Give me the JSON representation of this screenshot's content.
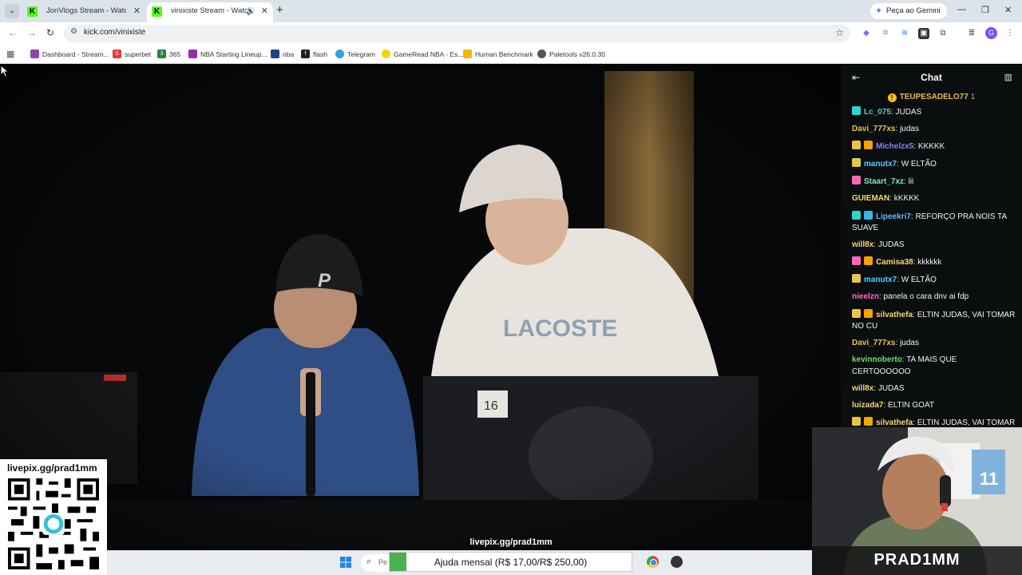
{
  "browser": {
    "tabs": [
      {
        "title": "JonVlogs Stream - Watch Live on Kick",
        "favicon": "K",
        "active": false
      },
      {
        "title": "vinixiste Stream - Watch Live on Kick",
        "favicon": "K",
        "active": true
      }
    ],
    "gemini_label": "Peça ao Gemini",
    "url": "kick.com/vinixiste",
    "bookmarks": [
      {
        "label": "Dashboard - Stream...",
        "color": "#8e44ad"
      },
      {
        "label": "superbet",
        "color": "#e53935",
        "glyph": "S"
      },
      {
        "label": "365",
        "color": "#1b8a3a",
        "glyph": "3"
      },
      {
        "label": "NBA Starting Lineup...",
        "color": "#9c27b0"
      },
      {
        "label": "nba",
        "color": "#1d428a"
      },
      {
        "label": "flash",
        "color": "#222",
        "glyph": "f"
      },
      {
        "label": "Telegram",
        "color": "#2aa3df"
      },
      {
        "label": "GameRead NBA - Es...",
        "color": "#f5d20b"
      },
      {
        "label": "Human Benchmark",
        "color": "#f7b500"
      },
      {
        "label": "Paletools v26.0.30",
        "color": "#555"
      }
    ]
  },
  "overlay": {
    "qr_url": "livepix.gg/prad1mm",
    "stream_url": "livepix.gg/prad1mm",
    "search_placeholder": "Pe",
    "donation_text": "Ajuda mensal (R$ 17,00/R$ 250,00)",
    "donation_current": 17,
    "donation_goal": 250,
    "webcam_name": "PRAD1MM"
  },
  "chat": {
    "title": "Chat",
    "pinned_user": "TEUPESADELO77",
    "pinned_count": "1",
    "messages": [
      {
        "badges": [
          "gift"
        ],
        "user": "Lc_075",
        "color": "#4fd1c5",
        "text": "JUDAS"
      },
      {
        "badges": [],
        "user": "Davi_777xs",
        "color": "#e8c547",
        "text": "judas"
      },
      {
        "badges": [
          "sub",
          "crown"
        ],
        "user": "Michelzx5",
        "color": "#8f7cff",
        "text": "KKKKK"
      },
      {
        "badges": [
          "sub"
        ],
        "user": "manutx7",
        "color": "#4fd1ff",
        "text": "W ELTÃO"
      },
      {
        "badges": [
          "pink"
        ],
        "user": "Staart_7xz",
        "color": "#7ee7c7",
        "text": "lii"
      },
      {
        "badges": [],
        "user": "GUIEMAN",
        "color": "#f5d76e",
        "text": "kKKKK"
      },
      {
        "badges": [
          "gift",
          "og"
        ],
        "user": "Lipeekri7",
        "color": "#60b8ff",
        "text": "REFORÇO PRA NOIS TA SUAVE"
      },
      {
        "badges": [],
        "user": "will8x",
        "color": "#f5d76e",
        "text": "JUDAS"
      },
      {
        "badges": [
          "pink",
          "crown"
        ],
        "user": "Camisa38",
        "color": "#f5d76e",
        "text": "kkkkkk"
      },
      {
        "badges": [
          "sub"
        ],
        "user": "manutx7",
        "color": "#4fd1ff",
        "text": "W ELTÃO"
      },
      {
        "badges": [],
        "user": "nieelzn",
        "color": "#ff6ec7",
        "text": "panela o cara dnv ai fdp"
      },
      {
        "badges": [
          "sub",
          "crown"
        ],
        "user": "silvathefa",
        "color": "#f5d76e",
        "text": "ELTIN JUDAS, VAI TOMAR NO CU"
      },
      {
        "badges": [],
        "user": "Davi_777xs",
        "color": "#e8c547",
        "text": "judas"
      },
      {
        "badges": [],
        "user": "kevinnoberto",
        "color": "#6ee06e",
        "text": "TA MAIS QUE CERTOOOOOO"
      },
      {
        "badges": [],
        "user": "will8x",
        "color": "#f5d76e",
        "text": "JUDAS"
      },
      {
        "badges": [],
        "user": "luizada7",
        "color": "#f5d76e",
        "text": "ELTIN GOAT"
      },
      {
        "badges": [
          "sub",
          "crown"
        ],
        "user": "silvathefa",
        "color": "#f5d76e",
        "text": "ELTIN JUDAS, VAI TOMAR NO CU"
      }
    ]
  },
  "colors": {
    "kick_green": "#53fc18",
    "chat_bg": "#0b0e0f",
    "progress_green": "#4caf50"
  }
}
